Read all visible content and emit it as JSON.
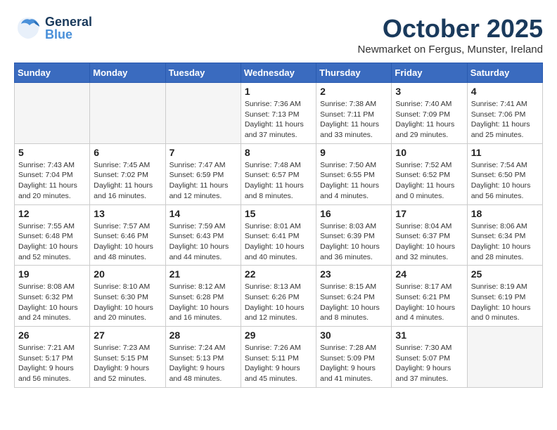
{
  "header": {
    "logo": {
      "general": "General",
      "blue": "Blue"
    },
    "title": "October 2025",
    "location": "Newmarket on Fergus, Munster, Ireland"
  },
  "weekdays": [
    "Sunday",
    "Monday",
    "Tuesday",
    "Wednesday",
    "Thursday",
    "Friday",
    "Saturday"
  ],
  "weeks": [
    [
      {
        "day": "",
        "info": ""
      },
      {
        "day": "",
        "info": ""
      },
      {
        "day": "",
        "info": ""
      },
      {
        "day": "1",
        "info": "Sunrise: 7:36 AM\nSunset: 7:13 PM\nDaylight: 11 hours\nand 37 minutes."
      },
      {
        "day": "2",
        "info": "Sunrise: 7:38 AM\nSunset: 7:11 PM\nDaylight: 11 hours\nand 33 minutes."
      },
      {
        "day": "3",
        "info": "Sunrise: 7:40 AM\nSunset: 7:09 PM\nDaylight: 11 hours\nand 29 minutes."
      },
      {
        "day": "4",
        "info": "Sunrise: 7:41 AM\nSunset: 7:06 PM\nDaylight: 11 hours\nand 25 minutes."
      }
    ],
    [
      {
        "day": "5",
        "info": "Sunrise: 7:43 AM\nSunset: 7:04 PM\nDaylight: 11 hours\nand 20 minutes."
      },
      {
        "day": "6",
        "info": "Sunrise: 7:45 AM\nSunset: 7:02 PM\nDaylight: 11 hours\nand 16 minutes."
      },
      {
        "day": "7",
        "info": "Sunrise: 7:47 AM\nSunset: 6:59 PM\nDaylight: 11 hours\nand 12 minutes."
      },
      {
        "day": "8",
        "info": "Sunrise: 7:48 AM\nSunset: 6:57 PM\nDaylight: 11 hours\nand 8 minutes."
      },
      {
        "day": "9",
        "info": "Sunrise: 7:50 AM\nSunset: 6:55 PM\nDaylight: 11 hours\nand 4 minutes."
      },
      {
        "day": "10",
        "info": "Sunrise: 7:52 AM\nSunset: 6:52 PM\nDaylight: 11 hours\nand 0 minutes."
      },
      {
        "day": "11",
        "info": "Sunrise: 7:54 AM\nSunset: 6:50 PM\nDaylight: 10 hours\nand 56 minutes."
      }
    ],
    [
      {
        "day": "12",
        "info": "Sunrise: 7:55 AM\nSunset: 6:48 PM\nDaylight: 10 hours\nand 52 minutes."
      },
      {
        "day": "13",
        "info": "Sunrise: 7:57 AM\nSunset: 6:46 PM\nDaylight: 10 hours\nand 48 minutes."
      },
      {
        "day": "14",
        "info": "Sunrise: 7:59 AM\nSunset: 6:43 PM\nDaylight: 10 hours\nand 44 minutes."
      },
      {
        "day": "15",
        "info": "Sunrise: 8:01 AM\nSunset: 6:41 PM\nDaylight: 10 hours\nand 40 minutes."
      },
      {
        "day": "16",
        "info": "Sunrise: 8:03 AM\nSunset: 6:39 PM\nDaylight: 10 hours\nand 36 minutes."
      },
      {
        "day": "17",
        "info": "Sunrise: 8:04 AM\nSunset: 6:37 PM\nDaylight: 10 hours\nand 32 minutes."
      },
      {
        "day": "18",
        "info": "Sunrise: 8:06 AM\nSunset: 6:34 PM\nDaylight: 10 hours\nand 28 minutes."
      }
    ],
    [
      {
        "day": "19",
        "info": "Sunrise: 8:08 AM\nSunset: 6:32 PM\nDaylight: 10 hours\nand 24 minutes."
      },
      {
        "day": "20",
        "info": "Sunrise: 8:10 AM\nSunset: 6:30 PM\nDaylight: 10 hours\nand 20 minutes."
      },
      {
        "day": "21",
        "info": "Sunrise: 8:12 AM\nSunset: 6:28 PM\nDaylight: 10 hours\nand 16 minutes."
      },
      {
        "day": "22",
        "info": "Sunrise: 8:13 AM\nSunset: 6:26 PM\nDaylight: 10 hours\nand 12 minutes."
      },
      {
        "day": "23",
        "info": "Sunrise: 8:15 AM\nSunset: 6:24 PM\nDaylight: 10 hours\nand 8 minutes."
      },
      {
        "day": "24",
        "info": "Sunrise: 8:17 AM\nSunset: 6:21 PM\nDaylight: 10 hours\nand 4 minutes."
      },
      {
        "day": "25",
        "info": "Sunrise: 8:19 AM\nSunset: 6:19 PM\nDaylight: 10 hours\nand 0 minutes."
      }
    ],
    [
      {
        "day": "26",
        "info": "Sunrise: 7:21 AM\nSunset: 5:17 PM\nDaylight: 9 hours\nand 56 minutes."
      },
      {
        "day": "27",
        "info": "Sunrise: 7:23 AM\nSunset: 5:15 PM\nDaylight: 9 hours\nand 52 minutes."
      },
      {
        "day": "28",
        "info": "Sunrise: 7:24 AM\nSunset: 5:13 PM\nDaylight: 9 hours\nand 48 minutes."
      },
      {
        "day": "29",
        "info": "Sunrise: 7:26 AM\nSunset: 5:11 PM\nDaylight: 9 hours\nand 45 minutes."
      },
      {
        "day": "30",
        "info": "Sunrise: 7:28 AM\nSunset: 5:09 PM\nDaylight: 9 hours\nand 41 minutes."
      },
      {
        "day": "31",
        "info": "Sunrise: 7:30 AM\nSunset: 5:07 PM\nDaylight: 9 hours\nand 37 minutes."
      },
      {
        "day": "",
        "info": ""
      }
    ]
  ]
}
